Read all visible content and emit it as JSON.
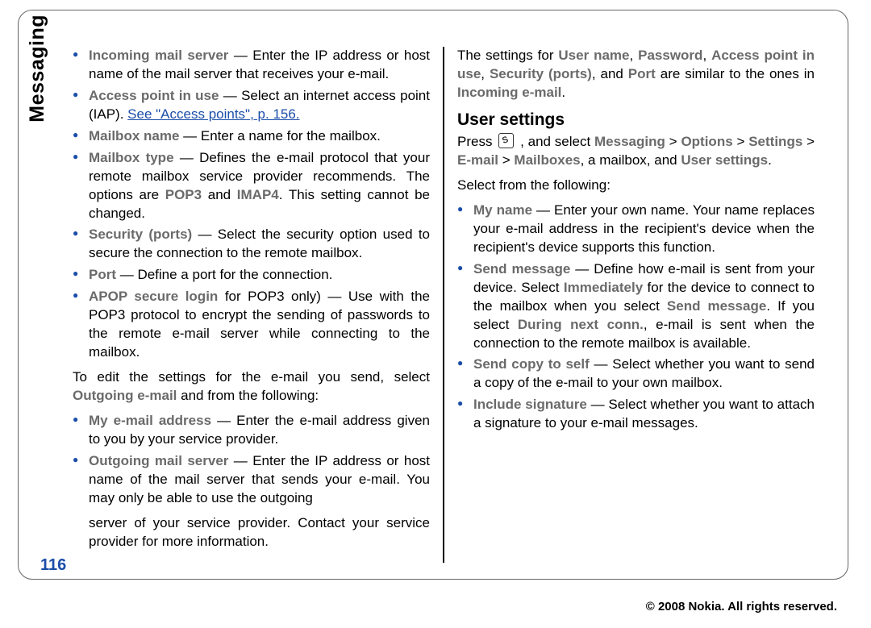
{
  "side_tab": "Messaging",
  "page_num": "116",
  "copyright": "© 2008 Nokia. All rights reserved.",
  "left": {
    "bul1_label": "Incoming mail server",
    "bul1_text": " — Enter the IP address or host name of the mail server that receives your e-mail.",
    "bul2_label": "Access point in use",
    "bul2_text1": " — Select an internet access point (IAP). ",
    "bul2_link": "See \"Access points\", p. 156.",
    "bul3_label": "Mailbox name",
    "bul3_text": " — Enter a name for the mailbox.",
    "bul4_label": "Mailbox type",
    "bul4_text1": " — Defines the e-mail protocol that your remote mailbox service provider recommends. The options are ",
    "bul4_opt1": "POP3",
    "bul4_mid": " and ",
    "bul4_opt2": "IMAP4",
    "bul4_text2": ". This setting cannot be changed.",
    "bul5_label": "Security (ports)",
    "bul5_text": " — Select the security option used to secure the connection to the remote mailbox.",
    "bul6_label": "Port",
    "bul6_text": " — Define a port for the connection.",
    "bul7_label": "APOP secure login",
    "bul7_text": " for POP3 only) — Use with the POP3 protocol to encrypt the sending of passwords to the remote e-mail server while connecting to the mailbox.",
    "outgoing_para1": "To edit the settings for the e-mail you send, select ",
    "outgoing_bold": "Outgoing e-mail",
    "outgoing_para2": " and from the following:",
    "bul8_label": "My e-mail address",
    "bul8_text": " — Enter the e-mail address given to you by your service provider.",
    "bul9_label": "Outgoing mail server",
    "bul9_text": " — Enter the IP address or host name of the mail server that sends your e-mail. You may only be able to use the outgoing"
  },
  "right": {
    "carry_text": "server of your service provider. Contact your service provider for more information.",
    "similar_para1": "The settings for ",
    "s_user": "User name",
    "s_sep1": ", ",
    "s_pass": "Password",
    "s_sep2": ", ",
    "s_ap": "Access point in use",
    "s_sep3": ", ",
    "s_sec": "Security (ports)",
    "s_sep4": ", and ",
    "s_port": "Port",
    "similar_para2": " are similar to the ones in ",
    "s_incoming": "Incoming e-mail",
    "similar_para3": ".",
    "heading": "User settings",
    "press": "Press ",
    "select": " , and select ",
    "path_msg": "Messaging",
    "gt": " > ",
    "path_opt": "Options",
    "path_set": "Settings",
    "path_em": "E-mail",
    "path_mb": "Mailboxes",
    "tail1": ", a mailbox, and ",
    "path_us": "User settings",
    "tail2": ".",
    "selectfrom": "Select from the following:",
    "rb1_label": "My name",
    "rb1_text": " — Enter your own name. Your name replaces your e-mail address in the recipient's device when the recipient's device supports this function.",
    "rb2_label": "Send message",
    "rb2_text1": " — Define how e-mail is sent from your device. Select ",
    "rb2_imm": "Immediately",
    "rb2_text2": " for the device to connect to the mailbox when you select ",
    "rb2_send": "Send message",
    "rb2_text3": ". If you select ",
    "rb2_dur": "During next conn.",
    "rb2_text4": ", e-mail is sent when the connection to the remote mailbox is available.",
    "rb3_label": "Send copy to self",
    "rb3_text": " — Select whether you want to send a copy of the e-mail to your own mailbox.",
    "rb4_label": "Include signature",
    "rb4_text": " — Select whether you want to attach a signature to your e-mail messages."
  }
}
